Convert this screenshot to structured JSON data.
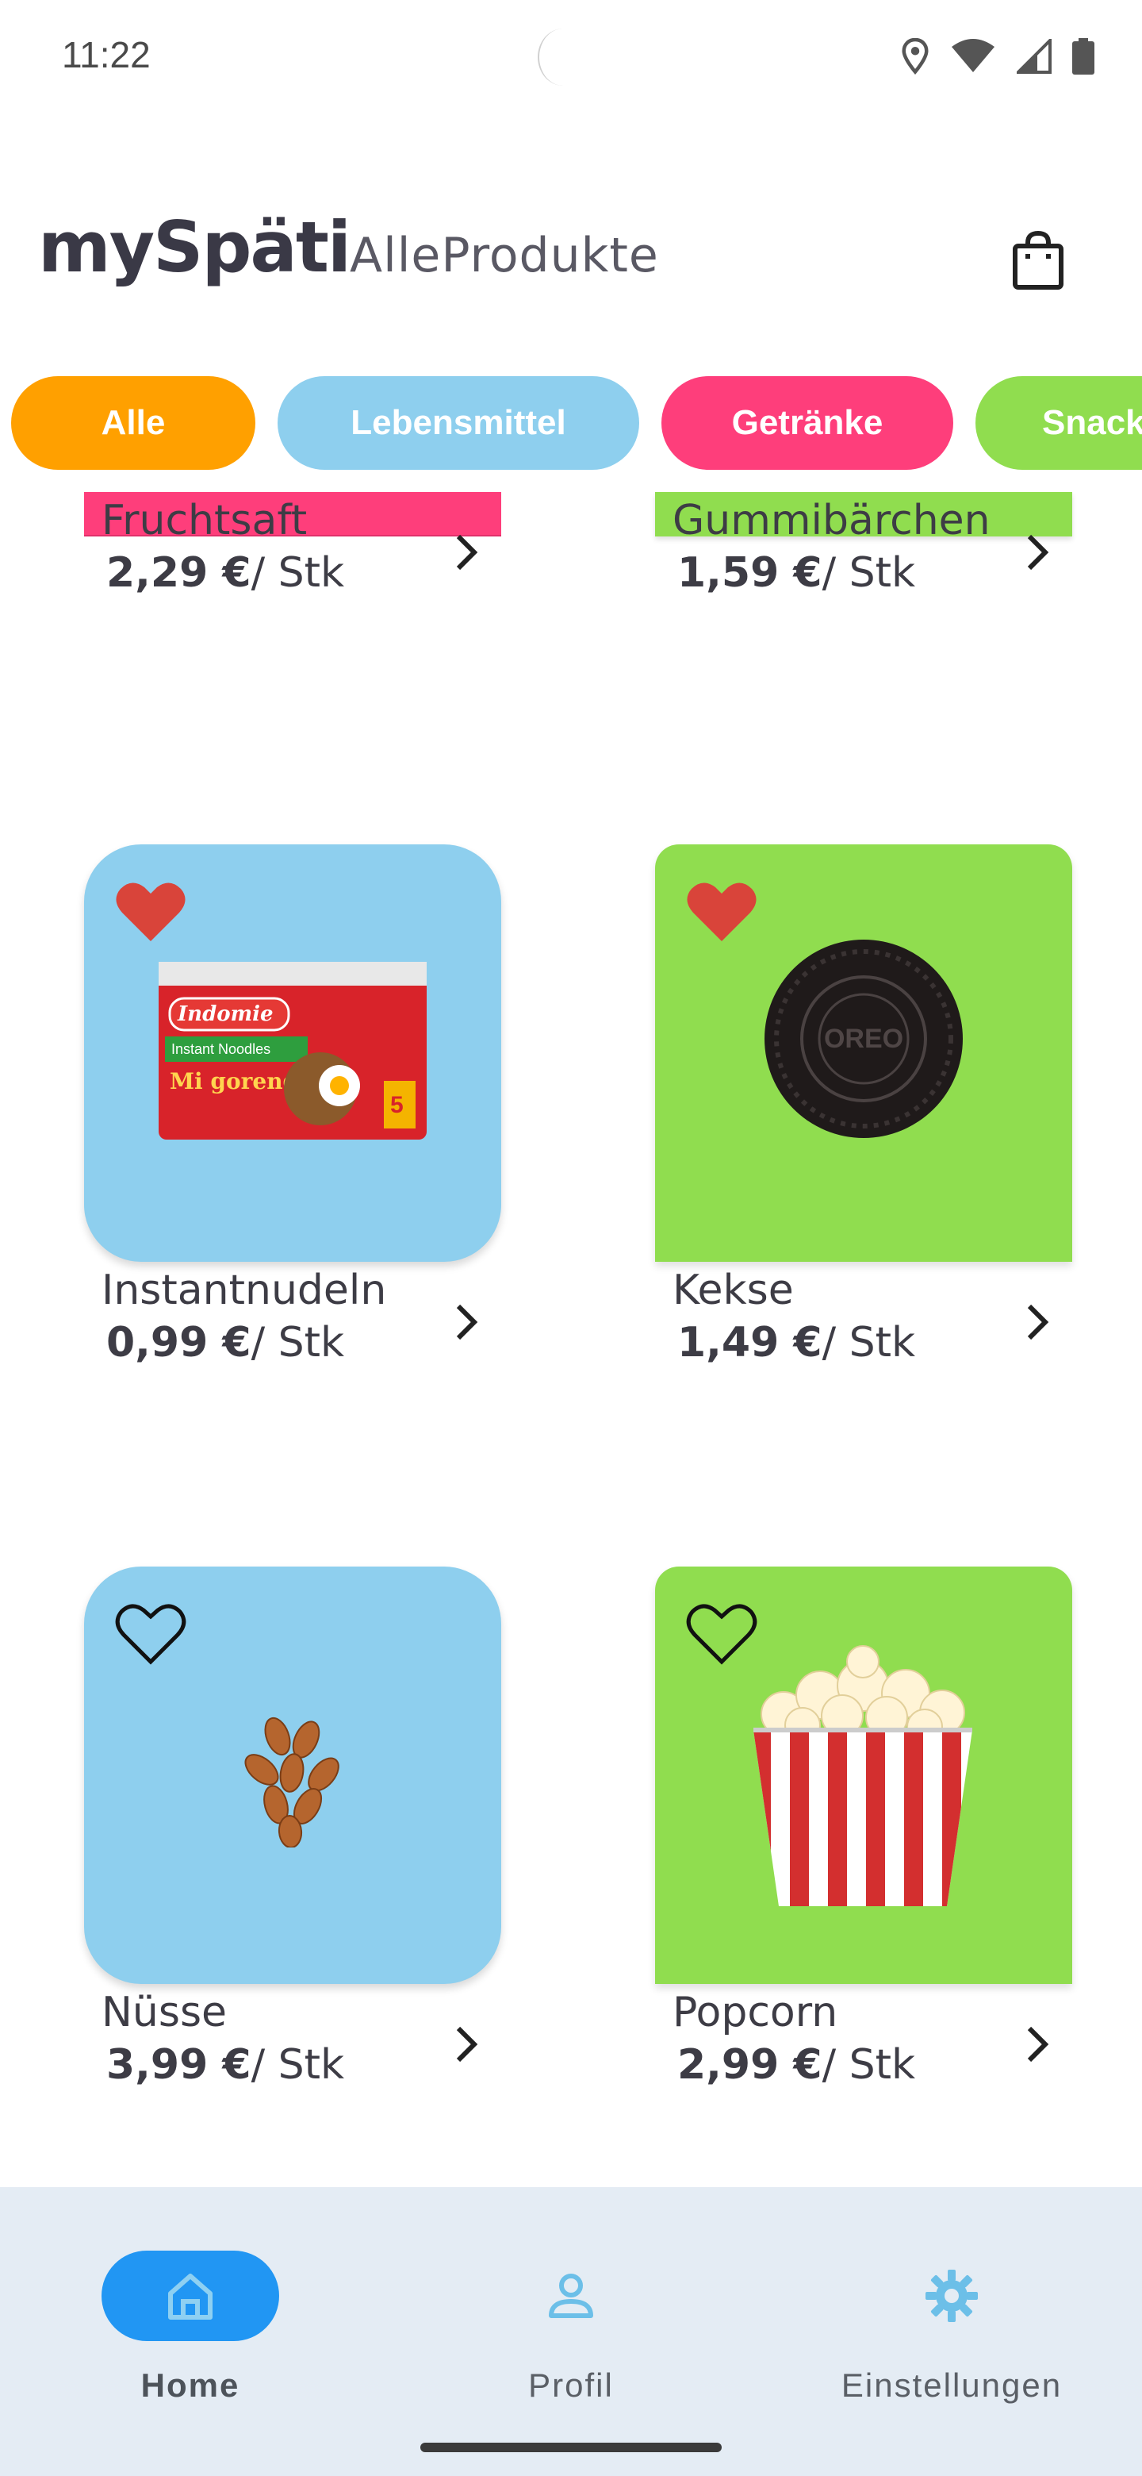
{
  "status_bar": {
    "time": "11:22",
    "icons": [
      "location-icon",
      "wifi-icon",
      "cell-signal-icon",
      "battery-icon"
    ]
  },
  "header": {
    "brand": "mySpäti",
    "subtitle": "AlleProdukte",
    "cart_icon": "shopping-bag-icon"
  },
  "categories": [
    {
      "label": "Alle",
      "color": "#ffa000"
    },
    {
      "label": "Lebensmittel",
      "color": "#8ecfee"
    },
    {
      "label": "Getränke",
      "color": "#fe3e7b"
    },
    {
      "label": "Snacks",
      "color": "#90dd4f"
    }
  ],
  "products": [
    {
      "name": "Fruchtsaft",
      "price": "2,29 €",
      "unit": "/ Stk",
      "color": "#fe3e7b",
      "favorite": null
    },
    {
      "name": "Gummibärchen",
      "price": "1,59 €",
      "unit": "/ Stk",
      "color": "#90dd4f",
      "favorite": null
    },
    {
      "name": "Instantnudeln",
      "price": "0,99 €",
      "unit": "/ Stk",
      "color": "#8ecfee",
      "favorite": true,
      "image": "instant-noodles-pack"
    },
    {
      "name": "Kekse",
      "price": "1,49 €",
      "unit": "/ Stk",
      "color": "#90dd4f",
      "favorite": true,
      "image": "oreo-cookie"
    },
    {
      "name": "Nüsse",
      "price": "3,99 €",
      "unit": "/ Stk",
      "color": "#8ecfee",
      "favorite": false,
      "image": "almonds"
    },
    {
      "name": "Popcorn",
      "price": "2,99 €",
      "unit": "/ Stk",
      "color": "#90dd4f",
      "favorite": false,
      "image": "popcorn-bucket"
    }
  ],
  "bottom_nav": {
    "items": [
      {
        "label": "Home",
        "icon": "home-icon",
        "active": true
      },
      {
        "label": "Profil",
        "icon": "person-icon",
        "active": false
      },
      {
        "label": "Einstellungen",
        "icon": "gear-icon",
        "active": false
      }
    ]
  },
  "colors": {
    "accent_blue": "#2196f3",
    "favorite_red": "#d9443a",
    "nav_background": "#e4ecf4"
  }
}
